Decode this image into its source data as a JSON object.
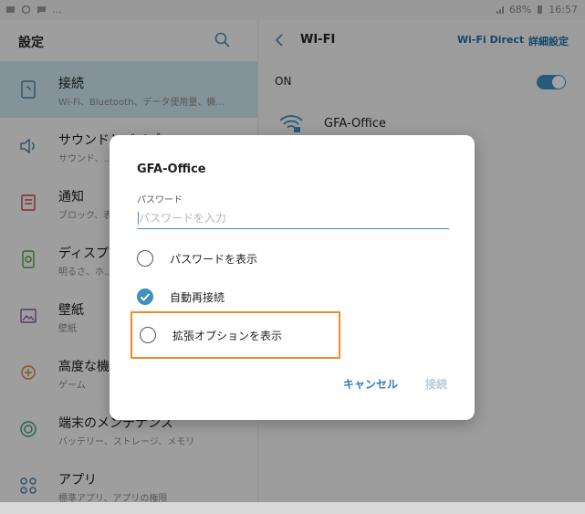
{
  "status_bar": {
    "battery": "68%",
    "time": "16:57",
    "dots": "..."
  },
  "settings": {
    "title": "設定",
    "items": [
      {
        "title": "接続",
        "subtitle": "Wi-Fi、Bluetooth、データ使用量、機...",
        "icon": "connection-icon",
        "selected": true
      },
      {
        "title": "サウンドとバイブ",
        "subtitle": "サウンド、...",
        "icon": "sound-icon"
      },
      {
        "title": "通知",
        "subtitle": "ブロック、表...",
        "icon": "notification-icon"
      },
      {
        "title": "ディスプレイ",
        "subtitle": "明るさ、ホ...",
        "icon": "display-icon"
      },
      {
        "title": "壁紙",
        "subtitle": "壁紙",
        "icon": "wallpaper-icon"
      },
      {
        "title": "高度な機能",
        "subtitle": "ゲーム",
        "icon": "advanced-features-icon"
      },
      {
        "title": "端末のメンテナンス",
        "subtitle": "バッテリー、ストレージ、メモリ",
        "icon": "device-maintenance-icon"
      },
      {
        "title": "アプリ",
        "subtitle": "標準アプリ、アプリの権限",
        "icon": "apps-icon"
      }
    ]
  },
  "wifi": {
    "title": "WI-FI",
    "wifi_direct": "Wi-Fi Direct",
    "advanced": "詳細設定",
    "on_label": "ON",
    "toggle_on": true,
    "network": "GFA-Office"
  },
  "dialog": {
    "title": "GFA-Office",
    "password_label": "パスワード",
    "password_placeholder": "パスワードを入力",
    "show_password": "パスワードを表示",
    "show_password_checked": false,
    "auto_reconnect": "自動再接続",
    "auto_reconnect_checked": true,
    "show_advanced": "拡張オプションを表示",
    "show_advanced_checked": false,
    "cancel": "キャンセル",
    "connect": "接続"
  },
  "colors": {
    "accent": "#3f8fc0",
    "highlight": "#f08a24",
    "selected_bg": "#cfe6ef"
  }
}
